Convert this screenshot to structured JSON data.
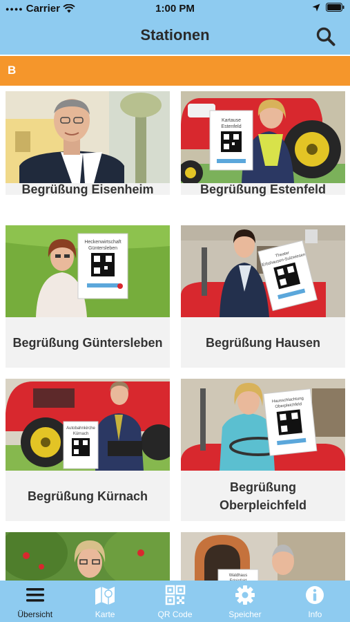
{
  "status_bar": {
    "carrier": "Carrier",
    "time": "1:00 PM"
  },
  "nav": {
    "title": "Stationen"
  },
  "section": {
    "letter": "B"
  },
  "stations": [
    {
      "title": "Begrüßung Eisenheim"
    },
    {
      "title": "Begrüßung Estenfeld",
      "sign": "Kartause Estenfeld"
    },
    {
      "title": "Begrüßung Güntersleben",
      "sign": "Heckenwirtschaft Güntersleben"
    },
    {
      "title": "Begrüßung Hausen",
      "sign": "Theater Erbshausen-Sulzwiesen"
    },
    {
      "title": "Begrüßung Kürnach",
      "sign": "Autobahnkirche Kürnach"
    },
    {
      "title": "Begrüßung Oberpleichfeld",
      "sign": "Hausschlachtung Oberpleichfeld"
    },
    {
      "title": ""
    },
    {
      "title": "",
      "sign": "Waldhaus Erleinfeld"
    }
  ],
  "tabbar": {
    "tabs": [
      {
        "label": "Übersicht",
        "icon": "menu-icon"
      },
      {
        "label": "Karte",
        "icon": "map-icon"
      },
      {
        "label": "QR Code",
        "icon": "qr-code-icon"
      },
      {
        "label": "Speicher",
        "icon": "gear-icon"
      },
      {
        "label": "Info",
        "icon": "info-icon"
      }
    ]
  },
  "colors": {
    "bar": "#8ecbf0",
    "section": "#f5962b",
    "card": "#f2f2f2",
    "tractor": "#d8282e"
  }
}
